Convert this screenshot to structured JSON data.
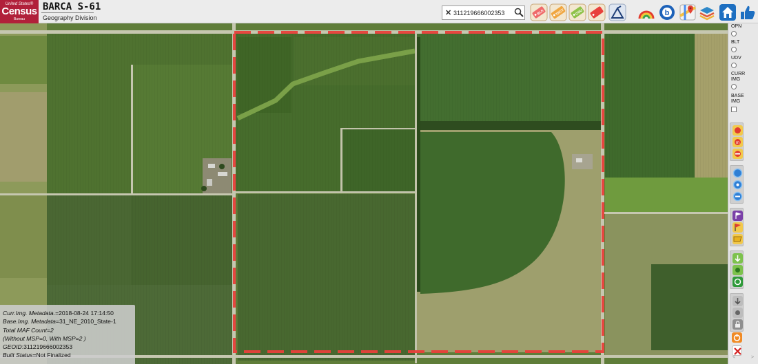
{
  "header": {
    "logo": {
      "top": "United States®",
      "main": "Census",
      "bottom": "Bureau"
    },
    "title": "BARCA  S-61",
    "subtitle": "Geography Division",
    "search": {
      "value": "311219666002353",
      "clear_icon": "close-icon",
      "search_icon": "magnifier-icon"
    },
    "tools": [
      {
        "name": "tag-blk-button",
        "label": "BLK",
        "color": "#ef6a6a"
      },
      {
        "name": "tag-trct-button",
        "label": "TRCT",
        "color": "#f0a640"
      },
      {
        "name": "tag-cou-button",
        "label": "COU",
        "color": "#8fc24a"
      },
      {
        "name": "tag-red-button",
        "label": "",
        "color": "#e8413c"
      },
      {
        "name": "measure-tool-button",
        "label": "",
        "color": "#1f3f79"
      },
      {
        "name": "rainbow-layer-button",
        "label": "",
        "color": "#f3c634"
      },
      {
        "name": "bing-map-button",
        "label": "",
        "color": "#1d62b9"
      },
      {
        "name": "google-maps-button",
        "label": "",
        "color": "#34a853"
      },
      {
        "name": "layers-button",
        "label": "",
        "color": "#2e88c9"
      },
      {
        "name": "home-button",
        "label": "",
        "color": "#1e6fc1"
      },
      {
        "name": "thumbs-up-button",
        "label": "",
        "color": "#1e6fc1"
      }
    ]
  },
  "sidebar": {
    "layers": [
      {
        "label": "OPN"
      },
      {
        "label": "BLT"
      },
      {
        "label": "UDV"
      },
      {
        "label": "CURR IMG"
      },
      {
        "label": "BASE IMG"
      }
    ],
    "scroll_left": "<",
    "scroll_right": ">"
  },
  "metadata": {
    "curr_img_key": "Curr.Img. Metadata.",
    "curr_img_value": "=2018-08-24 17:14:50",
    "base_img_key": "Base.Img. Metadata",
    "base_img_value": "=31_NE_2010_State-1",
    "maf_count": "Total MAF Count=2",
    "msp_note": "(Without MSP=0, With MSP=2 )",
    "geoid_key": "GEOID",
    "geoid_value": ":311219666002353",
    "built_status_key": "Built Status",
    "built_status_value": "=Not Finalized"
  },
  "map": {
    "boundary_color": "#e8403a"
  }
}
